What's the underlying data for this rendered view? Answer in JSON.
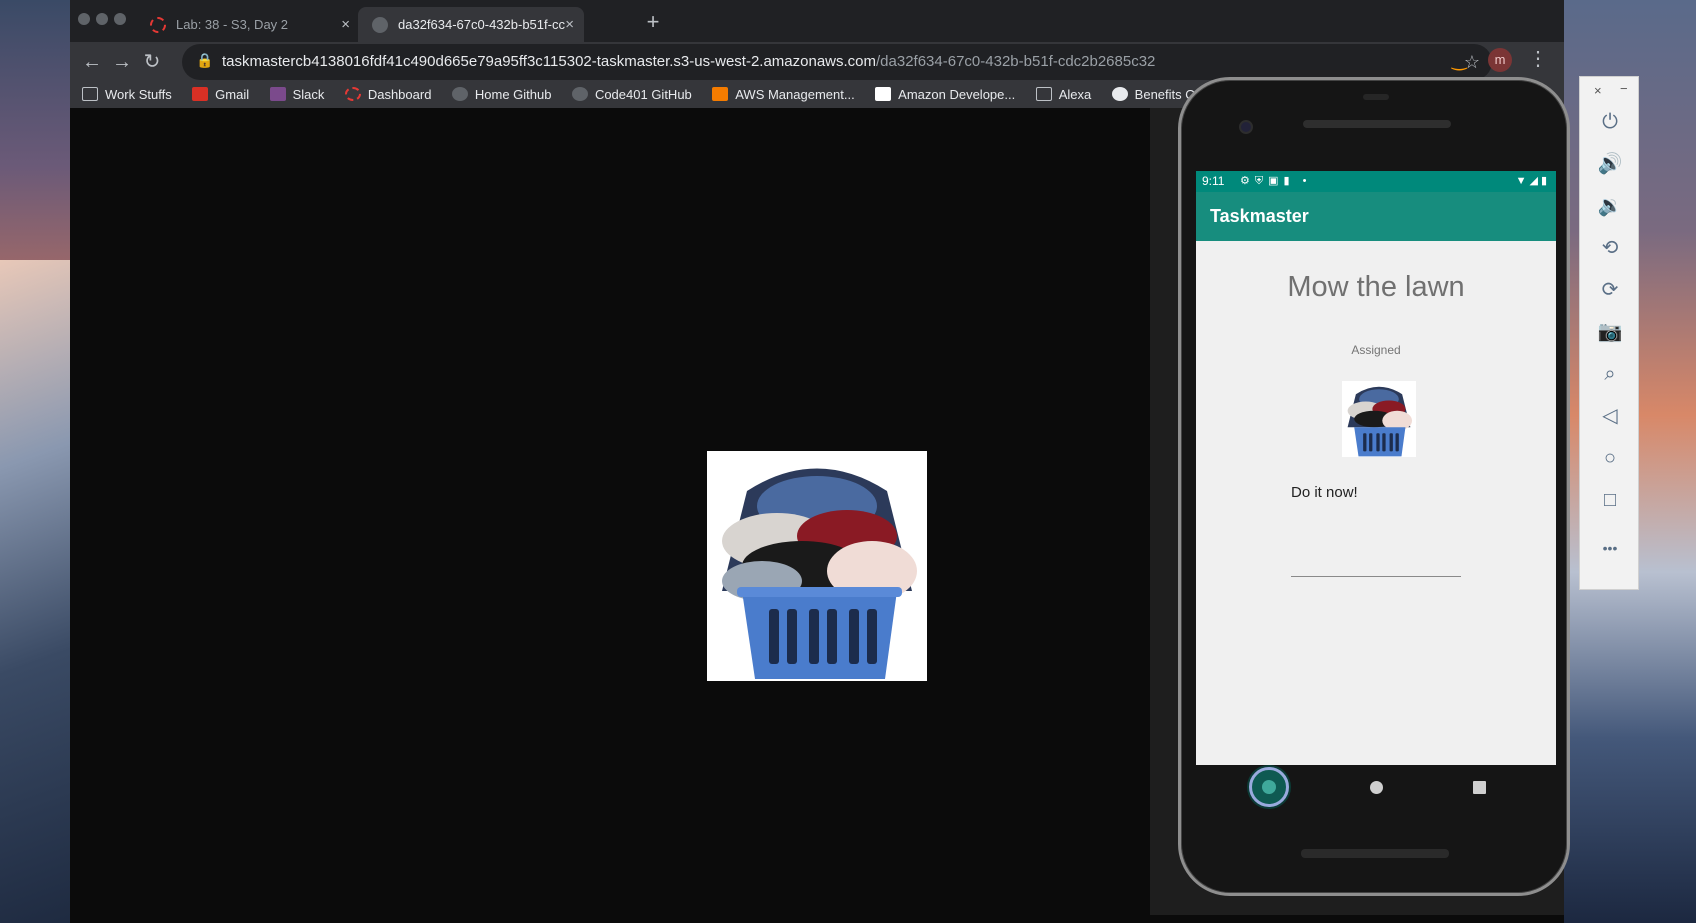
{
  "browser": {
    "tabs": [
      {
        "title": "Lab: 38 - S3, Day 2",
        "active": false
      },
      {
        "title": "da32f634-67c0-432b-b51f-cc",
        "active": true
      }
    ],
    "new_tab_glyph": "+",
    "close_glyph": "×",
    "url": {
      "host": "taskmastercb4138016fdf41c490d665e79a95ff3c115302-taskmaster.s3-us-west-2.amazonaws.com",
      "path": "/da32f634-67c0-432b-b51f-cdc2b2685c32"
    },
    "avatar_letter": "m",
    "bookmarks": [
      {
        "label": "Work Stuffs",
        "icon": "folder-icon"
      },
      {
        "label": "Gmail",
        "icon": "gmail-icon"
      },
      {
        "label": "Slack",
        "icon": "slack-icon"
      },
      {
        "label": "Dashboard",
        "icon": "dashboard-icon"
      },
      {
        "label": "Home Github",
        "icon": "github-icon"
      },
      {
        "label": "Code401 GitHub",
        "icon": "github-icon"
      },
      {
        "label": "AWS Management...",
        "icon": "aws-icon"
      },
      {
        "label": "Amazon Develope...",
        "icon": "amazon-icon"
      },
      {
        "label": "Alexa",
        "icon": "folder-icon"
      },
      {
        "label": "Benefits Open Enr",
        "icon": "globe-icon"
      }
    ]
  },
  "colors": {
    "accent": "#00897b",
    "appbar": "#178d7e",
    "page_bg": "#0b0b0b",
    "screen_bg": "#f0f0f0"
  },
  "phone": {
    "status": {
      "time": "9:11",
      "icons": "⚙⛨▣▮ •",
      "right": "▼◢▮"
    },
    "app_title": "Taskmaster",
    "task_title": "Mow the lawn",
    "task_status": "Assigned",
    "task_body": "Do it now!"
  },
  "emulator": {
    "close": "×",
    "minimize": "−",
    "buttons": [
      {
        "name": "power-icon",
        "glyph": "⏻"
      },
      {
        "name": "volume-up-icon",
        "glyph": "🔊"
      },
      {
        "name": "volume-down-icon",
        "glyph": "🔉"
      },
      {
        "name": "rotate-left-icon",
        "glyph": "⟲"
      },
      {
        "name": "rotate-right-icon",
        "glyph": "⟳"
      },
      {
        "name": "camera-icon",
        "glyph": "📷"
      },
      {
        "name": "zoom-icon",
        "glyph": "⌕"
      },
      {
        "name": "back-icon",
        "glyph": "◁"
      },
      {
        "name": "home-icon",
        "glyph": "○"
      },
      {
        "name": "overview-icon",
        "glyph": "□"
      },
      {
        "name": "more-icon",
        "glyph": "•••"
      }
    ]
  }
}
